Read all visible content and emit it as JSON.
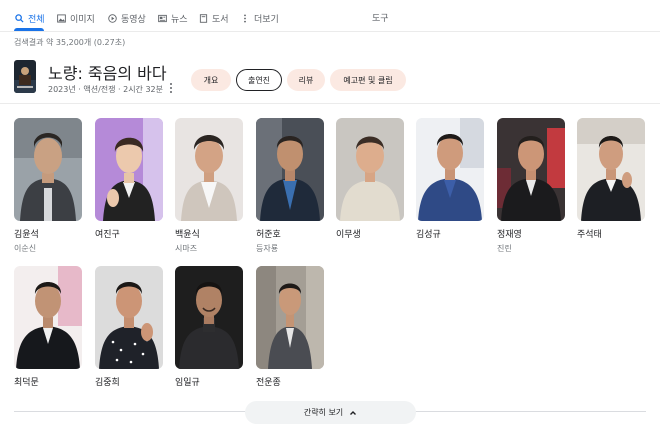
{
  "tabs": [
    {
      "label": "전체",
      "icon": "search-icon",
      "active": true
    },
    {
      "label": "이미지",
      "icon": "image-icon",
      "active": false
    },
    {
      "label": "동영상",
      "icon": "video-icon",
      "active": false
    },
    {
      "label": "뉴스",
      "icon": "news-icon",
      "active": false
    },
    {
      "label": "도서",
      "icon": "book-icon",
      "active": false
    },
    {
      "label": "더보기",
      "icon": "more-vert-icon",
      "active": false
    }
  ],
  "tools_label": "도구",
  "results_count": "검색결과 약 35,200개 (0.27초)",
  "movie": {
    "title": "노량: 죽음의 바다",
    "meta": "2023년 · 액션/전쟁 · 2시간 32분"
  },
  "chips": [
    {
      "label": "개요",
      "active": false
    },
    {
      "label": "출연진",
      "active": true
    },
    {
      "label": "리뷰",
      "active": false
    },
    {
      "label": "예고편 및 클립",
      "active": false
    }
  ],
  "cast": [
    {
      "name": "김윤석",
      "role": "이순신"
    },
    {
      "name": "여진구",
      "role": ""
    },
    {
      "name": "백윤식",
      "role": "시마즈"
    },
    {
      "name": "허준호",
      "role": "등자룡"
    },
    {
      "name": "이무생",
      "role": ""
    },
    {
      "name": "김성규",
      "role": ""
    },
    {
      "name": "정재영",
      "role": "진린"
    },
    {
      "name": "주석태",
      "role": ""
    },
    {
      "name": "최덕문",
      "role": ""
    },
    {
      "name": "김중희",
      "role": ""
    },
    {
      "name": "임일규",
      "role": ""
    },
    {
      "name": "전운종",
      "role": ""
    }
  ],
  "collapse_label": "간략히 보기",
  "colors": {
    "accent": "#1a73e8",
    "chip_bg": "#fbe9e2"
  }
}
